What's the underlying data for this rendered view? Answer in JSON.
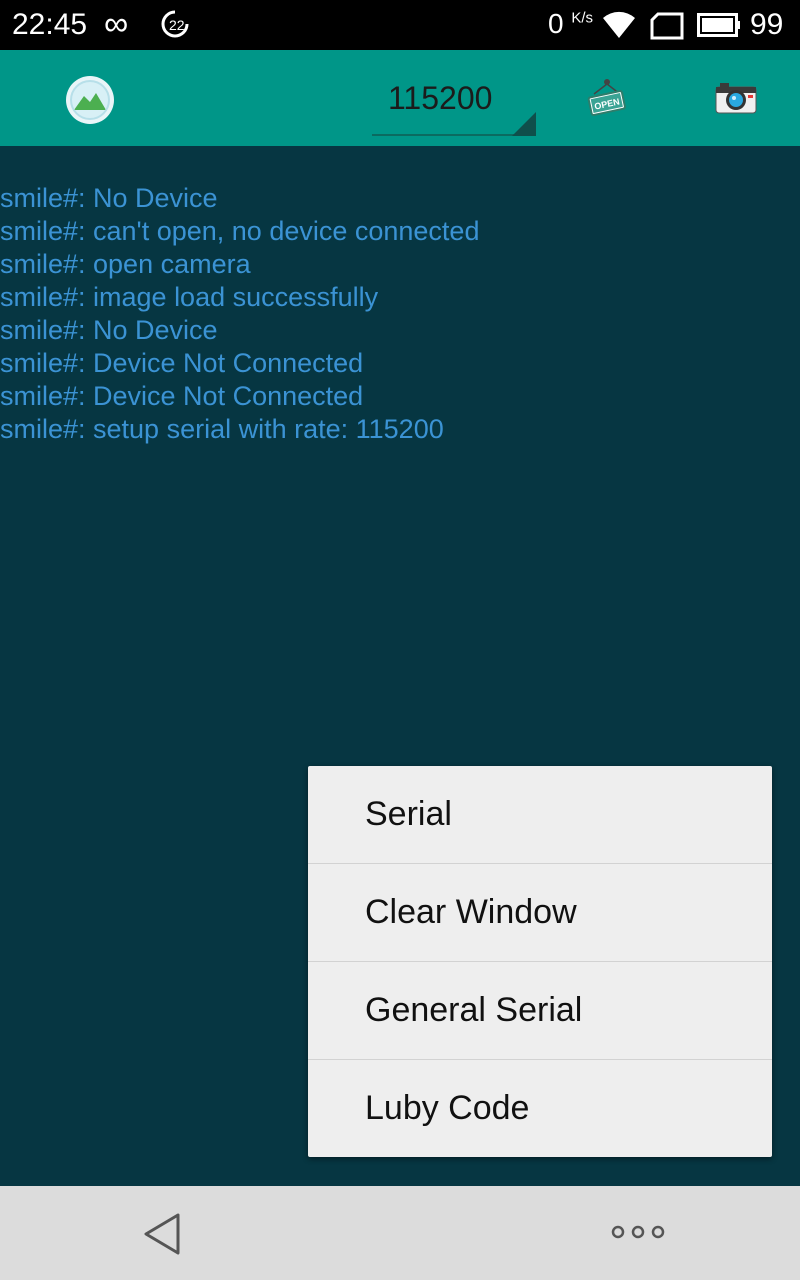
{
  "status_bar": {
    "time": "22:45",
    "notification_badge": "22",
    "net_speed": "0",
    "net_speed_unit": "K/s",
    "battery_level": "99",
    "icons": [
      "infinity-icon",
      "data-saver-icon",
      "wifi-icon",
      "sim-icon",
      "battery-icon"
    ]
  },
  "toolbar": {
    "baud_rate": "115200",
    "background": "#009688",
    "icons": [
      "app-logo-icon",
      "open-sign-icon",
      "camera-icon"
    ]
  },
  "log": {
    "color": "#3b93d4",
    "background": "#063642",
    "lines": [
      "smile#: No Device",
      "smile#: can't open, no device connected",
      "smile#: open camera",
      "smile#: image load successfully",
      "smile#: No Device",
      "smile#: Device Not Connected",
      "smile#: Device Not Connected",
      "smile#: setup serial with rate: 115200"
    ]
  },
  "menu": {
    "items": [
      "Serial",
      "Clear Window",
      "General Serial",
      "Luby Code"
    ]
  },
  "nav_bar": {
    "icons": [
      "back-icon",
      "more-icon"
    ]
  }
}
